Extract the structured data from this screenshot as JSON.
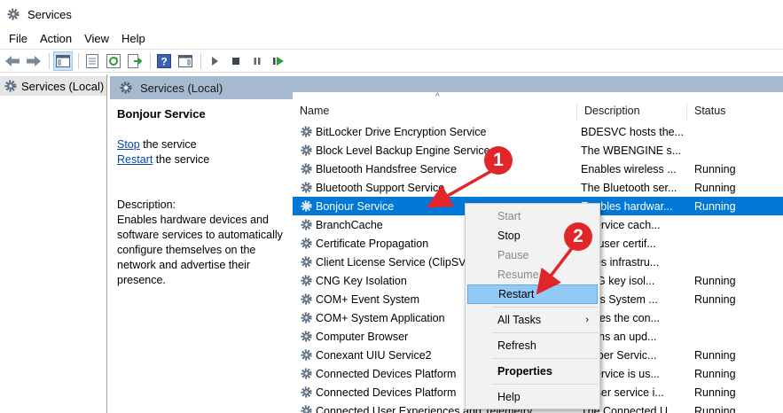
{
  "window": {
    "title": "Services",
    "icon": "gear-icon"
  },
  "menu": [
    "File",
    "Action",
    "View",
    "Help"
  ],
  "toolbar": {
    "buttons": [
      "back-arrow-icon",
      "forward-arrow-icon",
      "show-hide-console-tree-icon",
      "properties-icon",
      "refresh-icon",
      "export-list-icon",
      "help-icon",
      "show-action-pane-icon",
      "start-service-icon",
      "stop-service-icon",
      "pause-service-icon",
      "restart-service-icon"
    ]
  },
  "tree": {
    "item": "Services (Local)"
  },
  "panel": {
    "header": "Services (Local)"
  },
  "description_pane": {
    "service_title": "Bonjour Service",
    "stop_link": "Stop",
    "stop_suffix": " the service",
    "restart_link": "Restart",
    "restart_suffix": " the service",
    "desc_label": "Description:",
    "desc_text": "Enables hardware devices and software services to automatically configure themselves on the network and advertise their presence."
  },
  "columns": {
    "name": "Name",
    "description": "Description",
    "status": "Status"
  },
  "services": [
    {
      "name": "BitLocker Drive Encryption Service",
      "description": "BDESVC hosts the...",
      "status": ""
    },
    {
      "name": "Block Level Backup Engine Service",
      "description": "The WBENGINE s...",
      "status": ""
    },
    {
      "name": "Bluetooth Handsfree Service",
      "description": "Enables wireless ...",
      "status": "Running"
    },
    {
      "name": "Bluetooth Support Service",
      "description": "The Bluetooth ser...",
      "status": "Running"
    },
    {
      "name": "Bonjour Service",
      "description": "Enables hardwar...",
      "status": "Running"
    },
    {
      "name": "BranchCache",
      "description": "s service cach...",
      "status": ""
    },
    {
      "name": "Certificate Propagation",
      "description": "ies user certif...",
      "status": ""
    },
    {
      "name": "Client License Service (ClipSV",
      "description": "vides infrastru...",
      "status": ""
    },
    {
      "name": "CNG Key Isolation",
      "description": "CNG key isol...",
      "status": "Running"
    },
    {
      "name": "COM+ Event System",
      "description": "ports System ...",
      "status": "Running"
    },
    {
      "name": "COM+ System Application",
      "description": "nages the con...",
      "status": ""
    },
    {
      "name": "Computer Browser",
      "description": "ntains an upd...",
      "status": ""
    },
    {
      "name": "Conexant UIU Service2",
      "description": "Helper Servic...",
      "status": "Running"
    },
    {
      "name": "Connected Devices Platform",
      "description": "s service is us...",
      "status": "Running"
    },
    {
      "name": "Connected Devices Platform",
      "description": "s user service i...",
      "status": "Running"
    },
    {
      "name": "Connected User Experiences and Telemetry",
      "description": "The Connected U...",
      "status": "Running"
    }
  ],
  "context_menu": {
    "items": [
      {
        "label": "Start",
        "state": "disabled"
      },
      {
        "label": "Stop",
        "state": "normal"
      },
      {
        "label": "Pause",
        "state": "disabled"
      },
      {
        "label": "Resume",
        "state": "disabled"
      },
      {
        "label": "Restart",
        "state": "hover"
      },
      {
        "label": "All Tasks",
        "state": "submenu"
      },
      {
        "label": "Refresh",
        "state": "normal"
      },
      {
        "label": "Properties",
        "state": "bold"
      },
      {
        "label": "Help",
        "state": "normal"
      }
    ],
    "submenu_arrow": "›"
  },
  "annotations": {
    "callout1": "1",
    "callout2": "2",
    "color": "#e0262b"
  },
  "colors": {
    "selection": "#0078d7",
    "panel_header": "#a6b9cf",
    "menu_hover": "#91c9f7",
    "link": "#0645ad"
  }
}
